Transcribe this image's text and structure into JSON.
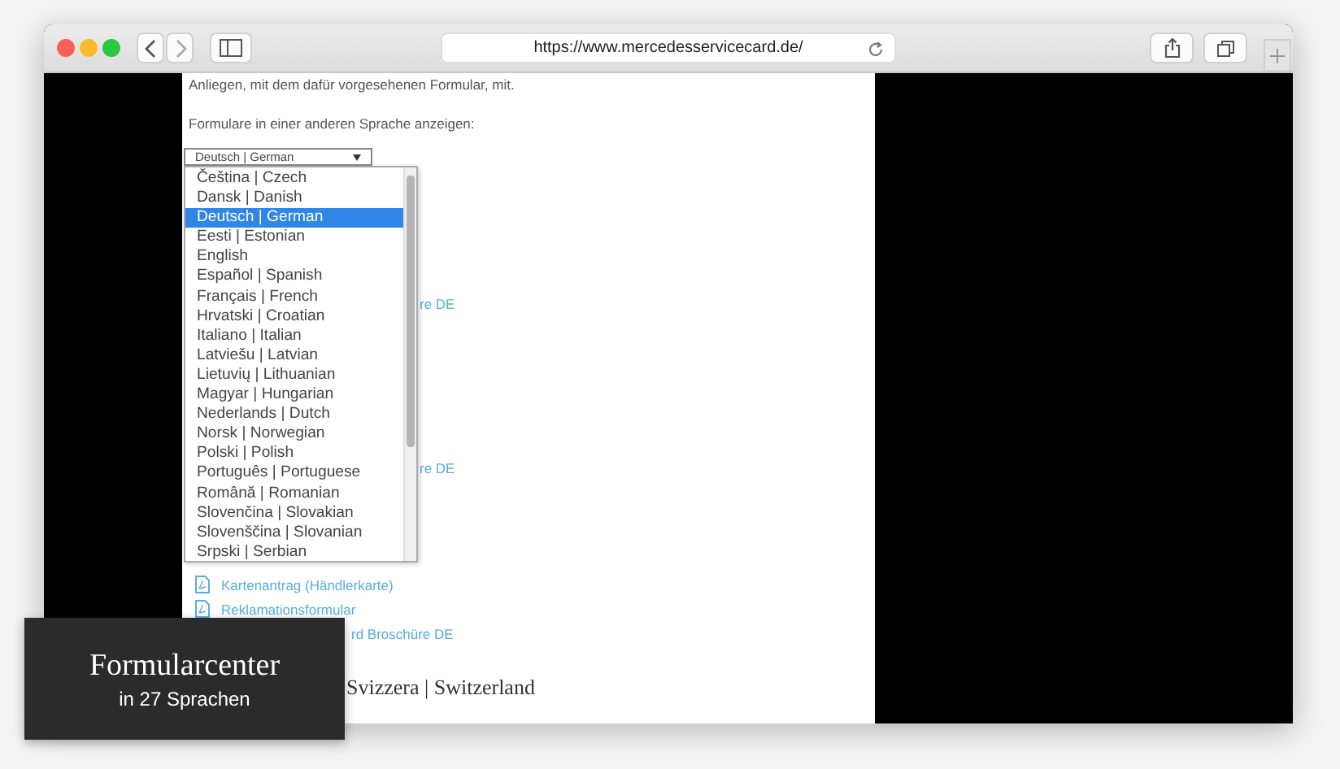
{
  "browser": {
    "url": "https://www.mercedesservicecard.de/"
  },
  "page": {
    "intro": "Anliegen, mit dem dafür vorgesehenen Formular, mit.",
    "language_prompt": "Formulare in einer anderen Sprache anzeigen:",
    "language_select": {
      "value": "Deutsch | German",
      "options": [
        {
          "label": "Čeština | Czech",
          "selected": false
        },
        {
          "label": "Dansk | Danish",
          "selected": false
        },
        {
          "label": "Deutsch | German",
          "selected": true
        },
        {
          "label": "Eesti | Estonian",
          "selected": false
        },
        {
          "label": "English",
          "selected": false
        },
        {
          "label": "Español | Spanish",
          "selected": false
        },
        {
          "label": "Français | French",
          "selected": false
        },
        {
          "label": "Hrvatski | Croatian",
          "selected": false
        },
        {
          "label": "Italiano | Italian",
          "selected": false
        },
        {
          "label": "Latviešu | Latvian",
          "selected": false
        },
        {
          "label": "Lietuvių | Lithuanian",
          "selected": false
        },
        {
          "label": "Magyar | Hungarian",
          "selected": false
        },
        {
          "label": "Nederlands | Dutch",
          "selected": false
        },
        {
          "label": "Norsk | Norwegian",
          "selected": false
        },
        {
          "label": "Polski | Polish",
          "selected": false
        },
        {
          "label": "Português | Portuguese",
          "selected": false
        },
        {
          "label": "Română | Romanian",
          "selected": false
        },
        {
          "label": "Slovenčina | Slovakian",
          "selected": false
        },
        {
          "label": "Slovenščina | Slovanian",
          "selected": false
        },
        {
          "label": "Srpski | Serbian",
          "selected": false
        }
      ]
    },
    "partial_links": [
      "re DE",
      "re DE"
    ],
    "links": [
      {
        "label": "Kartenantrag (Händlerkarte)",
        "kind": "pdf"
      },
      {
        "label": "Reklamationsformular",
        "kind": "pdf"
      },
      {
        "label": "rd Broschüre DE",
        "kind": "partial"
      }
    ],
    "footer_country": "Svizzera | Switzerland"
  },
  "caption": {
    "title": "Formularcenter",
    "subtitle": "in 27 Sprachen"
  }
}
